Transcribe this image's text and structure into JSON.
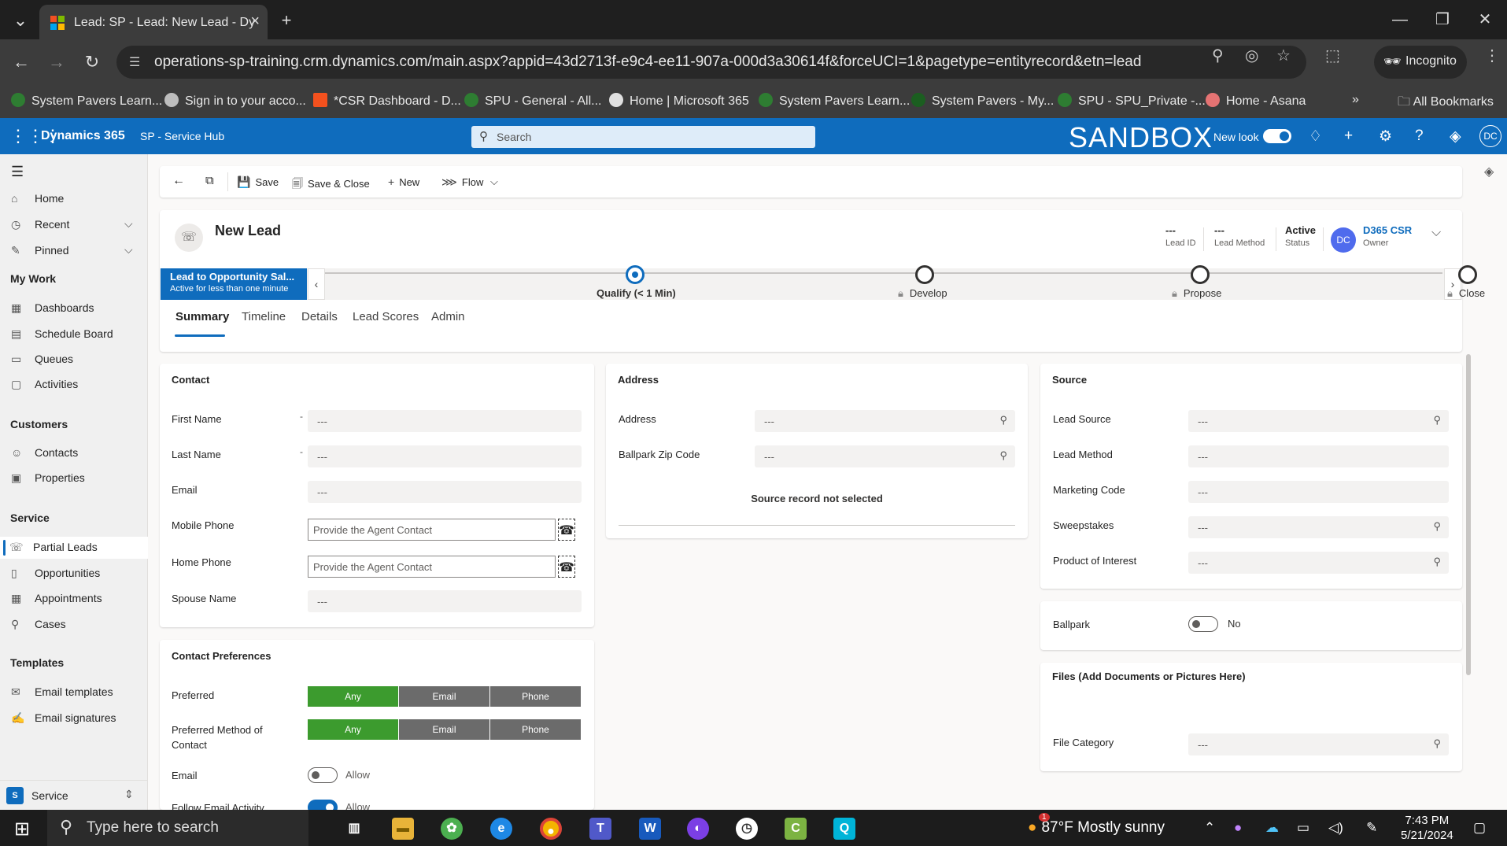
{
  "browser": {
    "tab_title": "Lead: SP - Lead: New Lead - Dy",
    "url": "operations-sp-training.crm.dynamics.com/main.aspx?appid=43d2713f-e9c4-ee11-907a-000d3a30614f&forceUCI=1&pagetype=entityrecord&etn=lead",
    "incognito_label": "Incognito",
    "bookmarks": [
      {
        "label": "System Pavers Learn...",
        "color": "#2e7d32"
      },
      {
        "label": "Sign in to your acco...",
        "color": "#bdbdbd"
      },
      {
        "label": "*CSR Dashboard - D...",
        "color": "#f4511e"
      },
      {
        "label": "SPU - General - All...",
        "color": "#2e7d32"
      },
      {
        "label": "Home | Microsoft 365",
        "color": "#e0e0e0"
      },
      {
        "label": "System Pavers Learn...",
        "color": "#2e7d32"
      },
      {
        "label": "System Pavers - My...",
        "color": "#1b5e20"
      },
      {
        "label": "SPU - SPU_Private -...",
        "color": "#2e7d32"
      },
      {
        "label": "Home - Asana",
        "color": "#e57373"
      }
    ],
    "all_bookmarks_label": "All Bookmarks"
  },
  "appbar": {
    "app_name": "Dynamics 365",
    "app_sub": "SP - Service Hub",
    "search_placeholder": "Search",
    "environment": "SANDBOX",
    "new_look_label": "New look",
    "user_initials": "DC",
    "accent": "#0f6cbd"
  },
  "sidebar": {
    "top": [
      {
        "label": "Home",
        "icon": "⌂"
      },
      {
        "label": "Recent",
        "icon": "◷"
      },
      {
        "label": "Pinned",
        "icon": "✎"
      }
    ],
    "groups": [
      {
        "title": "My Work",
        "items": [
          {
            "label": "Dashboards",
            "icon": "▦"
          },
          {
            "label": "Schedule Board",
            "icon": "▤"
          },
          {
            "label": "Queues",
            "icon": "▭"
          },
          {
            "label": "Activities",
            "icon": "▢"
          }
        ]
      },
      {
        "title": "Customers",
        "items": [
          {
            "label": "Contacts",
            "icon": "☺"
          },
          {
            "label": "Properties",
            "icon": "▣"
          }
        ]
      },
      {
        "title": "Service",
        "items": [
          {
            "label": "Partial Leads",
            "icon": "☏"
          },
          {
            "label": "Opportunities",
            "icon": "▯"
          },
          {
            "label": "Appointments",
            "icon": "▦"
          },
          {
            "label": "Cases",
            "icon": "⚲"
          }
        ]
      },
      {
        "title": "Templates",
        "items": [
          {
            "label": "Email templates",
            "icon": "✉"
          },
          {
            "label": "Email signatures",
            "icon": "✍"
          }
        ]
      }
    ],
    "area_badge": "S",
    "area_label": "Service"
  },
  "commands": {
    "save": "Save",
    "save_close": "Save & Close",
    "new": "New",
    "flow": "Flow"
  },
  "record": {
    "title": "New Lead",
    "header_fields": [
      {
        "value": "---",
        "label": "Lead ID"
      },
      {
        "value": "---",
        "label": "Lead Method"
      },
      {
        "value": "Active",
        "label": "Status"
      }
    ],
    "owner_initials": "DC",
    "owner_name": "D365 CSR",
    "owner_label": "Owner"
  },
  "bpf": {
    "name": "Lead to Opportunity Sal...",
    "status": "Active for less than one minute",
    "stages": [
      {
        "label": "Qualify  (< 1 Min)",
        "active": true
      },
      {
        "label": "Develop",
        "active": false
      },
      {
        "label": "Propose",
        "active": false
      },
      {
        "label": "Close",
        "active": false
      }
    ]
  },
  "tabs": [
    "Summary",
    "Timeline",
    "Details",
    "Lead Scores",
    "Admin"
  ],
  "contact": {
    "title": "Contact",
    "first_name_label": "First Name",
    "first_name_value": "---",
    "last_name_label": "Last Name",
    "last_name_value": "---",
    "email_label": "Email",
    "email_value": "---",
    "mobile_label": "Mobile Phone",
    "mobile_placeholder": "Provide the Agent Contact",
    "home_label": "Home Phone",
    "home_placeholder": "Provide the Agent Contact",
    "spouse_label": "Spouse Name",
    "spouse_value": "---"
  },
  "prefs": {
    "title": "Contact Preferences",
    "preferred_label": "Preferred",
    "preferred_method_label": "Preferred Method of Contact",
    "options": [
      "Any",
      "Email",
      "Phone"
    ],
    "selected": "Any",
    "email_label": "Email",
    "email_toggle": "Allow",
    "follow_label": "Follow Email Activity",
    "follow_toggle": "Allow"
  },
  "address": {
    "title": "Address",
    "address_label": "Address",
    "address_value": "---",
    "zip_label": "Ballpark Zip Code",
    "zip_value": "---",
    "message": "Source record not selected"
  },
  "source": {
    "title": "Source",
    "fields": [
      {
        "label": "Lead Source",
        "value": "---",
        "lookup": true
      },
      {
        "label": "Lead Method",
        "value": "---",
        "lookup": false
      },
      {
        "label": "Marketing Code",
        "value": "---",
        "lookup": false
      },
      {
        "label": "Sweepstakes",
        "value": "---",
        "lookup": true
      },
      {
        "label": "Product of Interest",
        "value": "---",
        "lookup": true
      }
    ]
  },
  "ballpark": {
    "label": "Ballpark",
    "toggle": "No"
  },
  "files": {
    "title": "Files (Add Documents or Pictures Here)",
    "category_label": "File Category",
    "category_value": "---"
  },
  "taskbar": {
    "search_placeholder": "Type here to search",
    "weather": "87°F  Mostly sunny",
    "weather_badge": "1",
    "time": "7:43 PM",
    "date": "5/21/2024"
  }
}
